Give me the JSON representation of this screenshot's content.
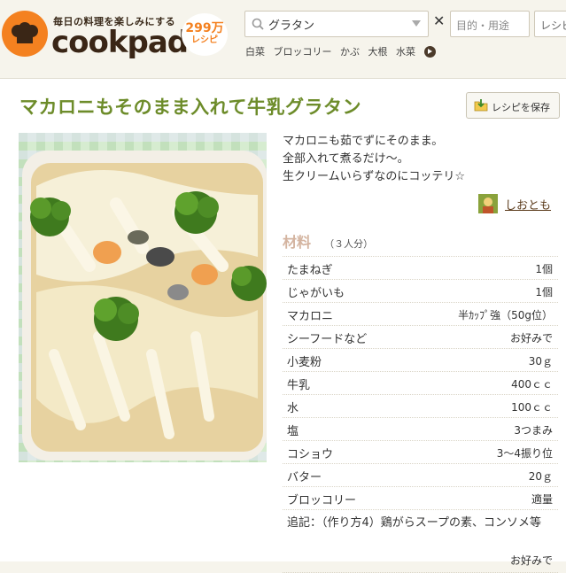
{
  "header": {
    "tagline": "毎日の料理を楽しみにする",
    "brand": "cookpad",
    "recipe_count": "299万",
    "recipe_unit": "レシピ",
    "search_value": "グラタン",
    "clear_label": "✕",
    "purpose_placeholder": "目的・用途",
    "recipe_button": "レシピ",
    "keywords": [
      "白菜",
      "ブロッコリー",
      "かぶ",
      "大根",
      "水菜"
    ]
  },
  "recipe": {
    "title": "マカロニもそのまま入れて牛乳グラタン",
    "save_label": "レシピを保存",
    "description": [
      "マカロニも茹でずにそのまま。",
      "全部入れて煮るだけ～。",
      "生クリームいらずなのにコッテリ☆"
    ],
    "author": "しおとも",
    "ingredients_title": "材料",
    "servings": "（３人分）",
    "ingredients": [
      {
        "name": "たまねぎ",
        "qty": "1個"
      },
      {
        "name": "じゃがいも",
        "qty": "1個"
      },
      {
        "name": "マカロニ",
        "qty": "半ｶｯﾌﾟ強（50g位）"
      },
      {
        "name": "シーフードなど",
        "qty": "お好みで"
      },
      {
        "name": "小麦粉",
        "qty": "30ｇ"
      },
      {
        "name": "牛乳",
        "qty": "400ｃｃ"
      },
      {
        "name": "水",
        "qty": "100ｃｃ"
      },
      {
        "name": "塩",
        "qty": "3つまみ"
      },
      {
        "name": "コショウ",
        "qty": "3～4振り位"
      },
      {
        "name": "バター",
        "qty": "20ｇ"
      },
      {
        "name": "ブロッコリー",
        "qty": "適量"
      },
      {
        "name": "追記：（作り方4）鶏がらスープの素、コンソメ等",
        "qty": "お好みで"
      }
    ]
  },
  "colors": {
    "brand_orange": "#f48120",
    "title_green": "#6d8c2a"
  }
}
